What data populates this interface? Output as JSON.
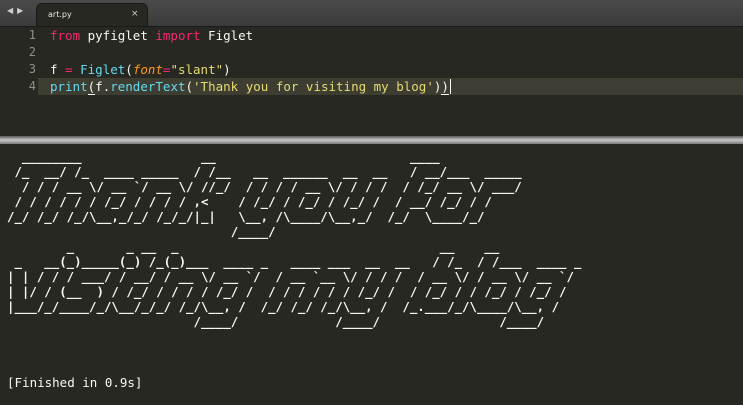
{
  "tab": {
    "filename": "art.py",
    "close_glyph": "×"
  },
  "nav": {
    "back_glyph": "◀",
    "forward_glyph": "▶"
  },
  "editor": {
    "line_numbers": [
      "1",
      "2",
      "3",
      "4"
    ],
    "line1": {
      "kw_from": "from",
      "mod": " pyfiglet ",
      "kw_import": "import",
      "name": " Figlet"
    },
    "line3": {
      "lhs": "f ",
      "eq": "=",
      "sp": " ",
      "cls": "Figlet",
      "open": "(",
      "param": "font",
      "eq2": "=",
      "str": "\"slant\"",
      "close": ")"
    },
    "line4": {
      "fn": "print",
      "open": "(",
      "obj": "f.",
      "method": "renderText",
      "open2": "(",
      "str": "'Thank you for visiting my blog'",
      "close2": ")",
      "close": ")"
    }
  },
  "output": {
    "ascii_art": "  ________                __                          ____\n /_  __/ /_  ____ _____  / /__   __  ______  __  __   / __/___  _____\n  / / / __ \\/ __ `/ __ \\/ //_/  / / / / __ \\/ / / /  / /_/ __ \\/ ___/\n / / / / / / /_/ / / / / ,<    / /_/ / /_/ / /_/ /  / __/ /_/ / /\n/_/ /_/ /_/\\__,_/_/ /_/_/|_|   \\__, /\\____/\\__,_/  /_/  \\____/_/\n                              /____/\n        _       _ __  _                                   __    __\n _   __(_)_____(_) /_(_)___  ____ _   ____ ___  __  __   / /_  / /___  ____ _\n| | / / / ___/ / __/ / __ \\/ __ `/  / __ `__ \\/ / / /  / __ \\/ / __ \\/ __ `/\n| |/ / (__  ) / /_/ / / / / /_/ /  / / / / / / /_/ /  / /_/ / / /_/ / /_/ /\n|___/_/____/_/\\__/_/_/ /_/\\__, /  /_/ /_/ /_/\\__, /  /_.___/_/\\____/\\__, /\n                         /____/             /____/                /____/",
    "finished_text": "[Finished in 0.9s]"
  }
}
